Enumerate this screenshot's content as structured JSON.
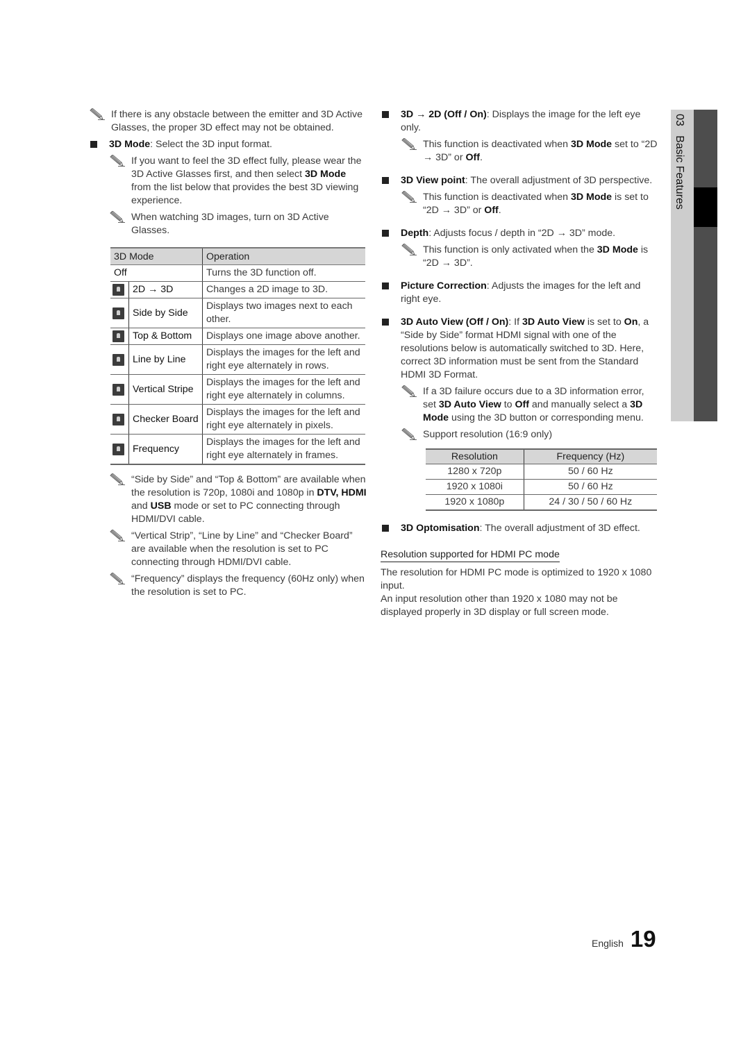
{
  "left": {
    "note_obstacle": "If there is any obstacle between the emitter and 3D Active Glasses, the proper 3D effect may not be obtained.",
    "mode_bullet": {
      "term": "3D Mode",
      "text": ": Select the 3D input format."
    },
    "note_wear": {
      "pre": "If you want to feel the 3D effect fully, please wear the 3D Active Glasses first, and then select ",
      "bold": "3D Mode",
      "post": " from the list below that provides the best 3D viewing experience."
    },
    "note_watch": "When watching 3D images, turn on 3D Active Glasses.",
    "mode_table": {
      "headers": [
        "3D Mode",
        "Operation"
      ],
      "off_row": {
        "mode": "Off",
        "operation": "Turns the 3D function off."
      },
      "rows": [
        {
          "icon": "2d-to-3d-icon",
          "mode": "2D → 3D",
          "operation": "Changes a 2D image to 3D."
        },
        {
          "icon": "side-by-side-icon",
          "mode": "Side by Side",
          "operation": "Displays two images next to each other."
        },
        {
          "icon": "top-bottom-icon",
          "mode": "Top & Bottom",
          "operation": "Displays one image above another."
        },
        {
          "icon": "line-by-line-icon",
          "mode": "Line by Line",
          "operation": "Displays the images for the left and right eye alternately in rows."
        },
        {
          "icon": "vertical-stripe-icon",
          "mode": "Vertical Stripe",
          "operation": "Displays the images for the left and right eye alternately in columns."
        },
        {
          "icon": "checker-board-icon",
          "mode": "Checker Board",
          "operation": "Displays the images for the left and right eye alternately in pixels."
        },
        {
          "icon": "frequency-icon",
          "mode": "Frequency",
          "operation": "Displays the images for the left and right eye alternately in frames."
        }
      ]
    },
    "note_sbs": {
      "pre": "“Side by Side” and “Top & Bottom” are available when the resolution is 720p, 1080i and 1080p in ",
      "b1": "DTV, HDMI",
      "mid": " and ",
      "b2": "USB",
      "post": " mode or set to PC connecting through HDMI/DVI cable."
    },
    "note_vs": "“Vertical Strip”, “Line by Line” and “Checker Board” are available when the resolution is set to PC connecting through HDMI/DVI cable.",
    "note_freq": "“Frequency” displays the frequency (60Hz only) when the resolution is set to PC."
  },
  "right": {
    "b_3d2d": {
      "term": "3D → 2D (Off / On)",
      "text": ": Displays the image for the left eye only."
    },
    "n_3d2d": {
      "pre": "This function is deactivated when ",
      "bold": "3D Mode",
      "mid": " set to “2D → 3D” or ",
      "bold2": "Off",
      "post": "."
    },
    "b_view": {
      "term": "3D View point",
      "text": ": The overall adjustment of 3D perspective."
    },
    "n_view": {
      "pre": "This function is deactivated when ",
      "bold": "3D Mode",
      "mid": " is set to “2D → 3D” or ",
      "bold2": "Off",
      "post": "."
    },
    "b_depth": {
      "term": "Depth",
      "text": ": Adjusts focus / depth in “2D → 3D” mode."
    },
    "n_depth": {
      "pre": "This function is only activated when the ",
      "bold": "3D Mode",
      "post": " is “2D → 3D”."
    },
    "b_pic": {
      "term": "Picture Correction",
      "text": ": Adjusts the images for the left and right eye."
    },
    "b_auto": {
      "term": "3D Auto View (Off / On)",
      "t1": ": If ",
      "b1": "3D Auto View",
      "t2": " is set to ",
      "b2": "On",
      "t3": ", a “Side by Side” format HDMI signal with one of the resolutions below is automatically switched to 3D. Here, correct 3D information must be sent from the Standard HDMI 3D Format."
    },
    "n_fail": {
      "t1": "If a 3D failure occurs due to a 3D information error, set ",
      "b1": "3D Auto View",
      "t2": " to ",
      "b2": "Off",
      "t3": " and manually select a ",
      "b3": "3D Mode",
      "t4": " using the 3D button or corresponding menu."
    },
    "n_support": "Support resolution (16:9 only)",
    "res_table": {
      "headers": [
        "Resolution",
        "Frequency (Hz)"
      ],
      "rows": [
        [
          "1280 x 720p",
          "50 / 60 Hz"
        ],
        [
          "1920 x 1080i",
          "50 / 60 Hz"
        ],
        [
          "1920 x 1080p",
          "24 / 30 / 50 / 60 Hz"
        ]
      ]
    },
    "b_opt": {
      "term": "3D Optomisation",
      "text": ": The overall adjustment of 3D effect."
    },
    "pc_heading": "Resolution supported for HDMI PC mode",
    "pc_p1": "The resolution for HDMI PC mode is optimized to 1920 x 1080 input.",
    "pc_p2": "An input resolution other than 1920 x 1080 may not be displayed properly in 3D display or full screen mode."
  },
  "sidetab": {
    "chapter": "03",
    "title": "Basic Features"
  },
  "footer": {
    "language": "English",
    "page": "19"
  }
}
